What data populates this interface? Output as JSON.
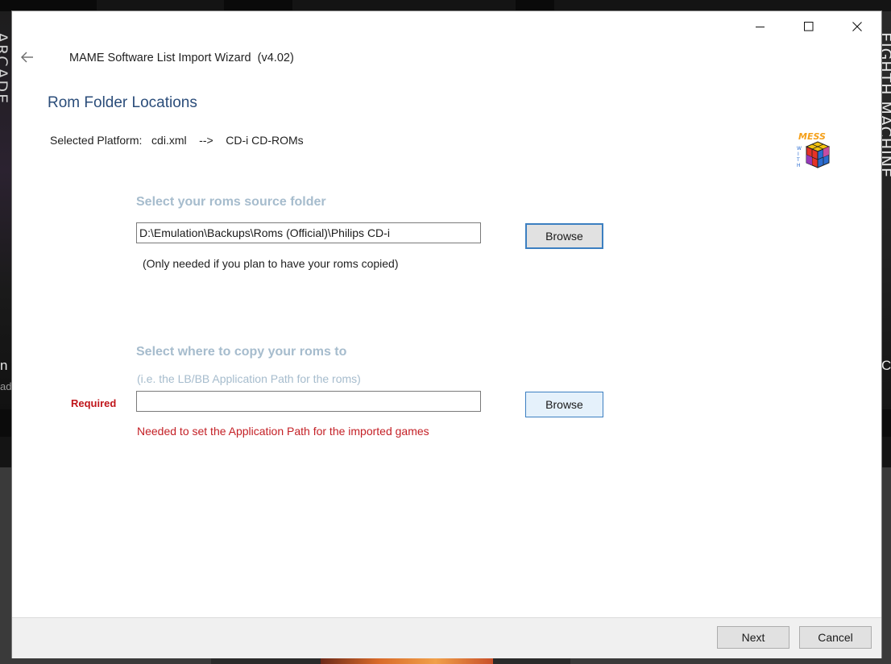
{
  "background": {
    "left_card_text": "ARCADE",
    "right_card_text": "EIGHTH MACHINE",
    "left_partial_text": "n",
    "left_partial_subtext": "ada",
    "right_partial_text": "C"
  },
  "window": {
    "title": "MAME Software List Import Wizard  (v4.02)",
    "icons": {
      "back": "arrow-left-icon",
      "minimize": "minimize-icon",
      "maximize": "maximize-icon",
      "close": "close-icon"
    }
  },
  "page": {
    "heading": "Rom Folder Locations",
    "platform_line": "Selected Platform:   cdi.xml    -->    CD-i CD-ROMs",
    "logo": {
      "word": "MESS",
      "with": "WITH",
      "icon": "rubiks-cube-icon",
      "colors": [
        "#f5a01a",
        "#e63327",
        "#2a6cd1",
        "#8a3bd1",
        "#f4c20d",
        "#e0489b"
      ]
    }
  },
  "source": {
    "heading": "Select your roms source folder",
    "path_value": "D:\\Emulation\\Backups\\Roms (Official)\\Philips CD-i",
    "browse_label": "Browse",
    "note": "(Only needed if you plan to have your roms copied)"
  },
  "destination": {
    "heading": "Select where to copy your roms to",
    "hint": "(i.e.  the LB/BB Application Path for the roms)",
    "required_label": "Required",
    "path_value": "",
    "browse_label": "Browse",
    "needed_note": "Needed to set the Application Path for the imported games"
  },
  "footer": {
    "next_label": "Next",
    "cancel_label": "Cancel"
  },
  "colors": {
    "heading_blue": "#2b4d7a",
    "group_heading": "#a6bccd",
    "required_red": "#c0161b",
    "focus_border": "#3c7fc1"
  }
}
